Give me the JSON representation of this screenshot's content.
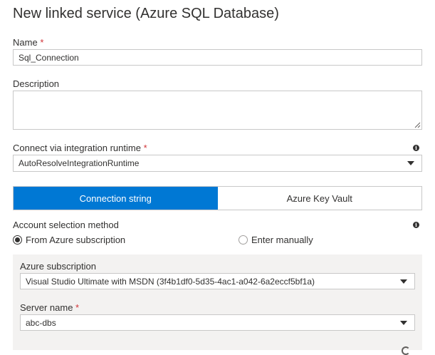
{
  "title": "New linked service (Azure SQL Database)",
  "name": {
    "label": "Name",
    "required_mark": "*",
    "value": "Sql_Connection"
  },
  "description": {
    "label": "Description",
    "value": ""
  },
  "runtime": {
    "label": "Connect via integration runtime",
    "required_mark": "*",
    "value": "AutoResolveIntegrationRuntime",
    "info_icon": "info-icon"
  },
  "tabs": [
    {
      "label": "Connection string",
      "active": true
    },
    {
      "label": "Azure Key Vault",
      "active": false
    }
  ],
  "account_method": {
    "label": "Account selection method",
    "options": [
      {
        "label": "From Azure subscription",
        "selected": true
      },
      {
        "label": "Enter manually",
        "selected": false
      }
    ]
  },
  "subscription": {
    "label": "Azure subscription",
    "value": "Visual Studio Ultimate with MSDN (3f4b1df0-5d35-4ac1-a042-6a2eccf5bf1a)"
  },
  "server": {
    "label": "Server name",
    "required_mark": "*",
    "value": "abc-dbs"
  },
  "colors": {
    "accent": "#0078d4",
    "required": "#d13438",
    "panel_bg": "#f3f2f1"
  }
}
